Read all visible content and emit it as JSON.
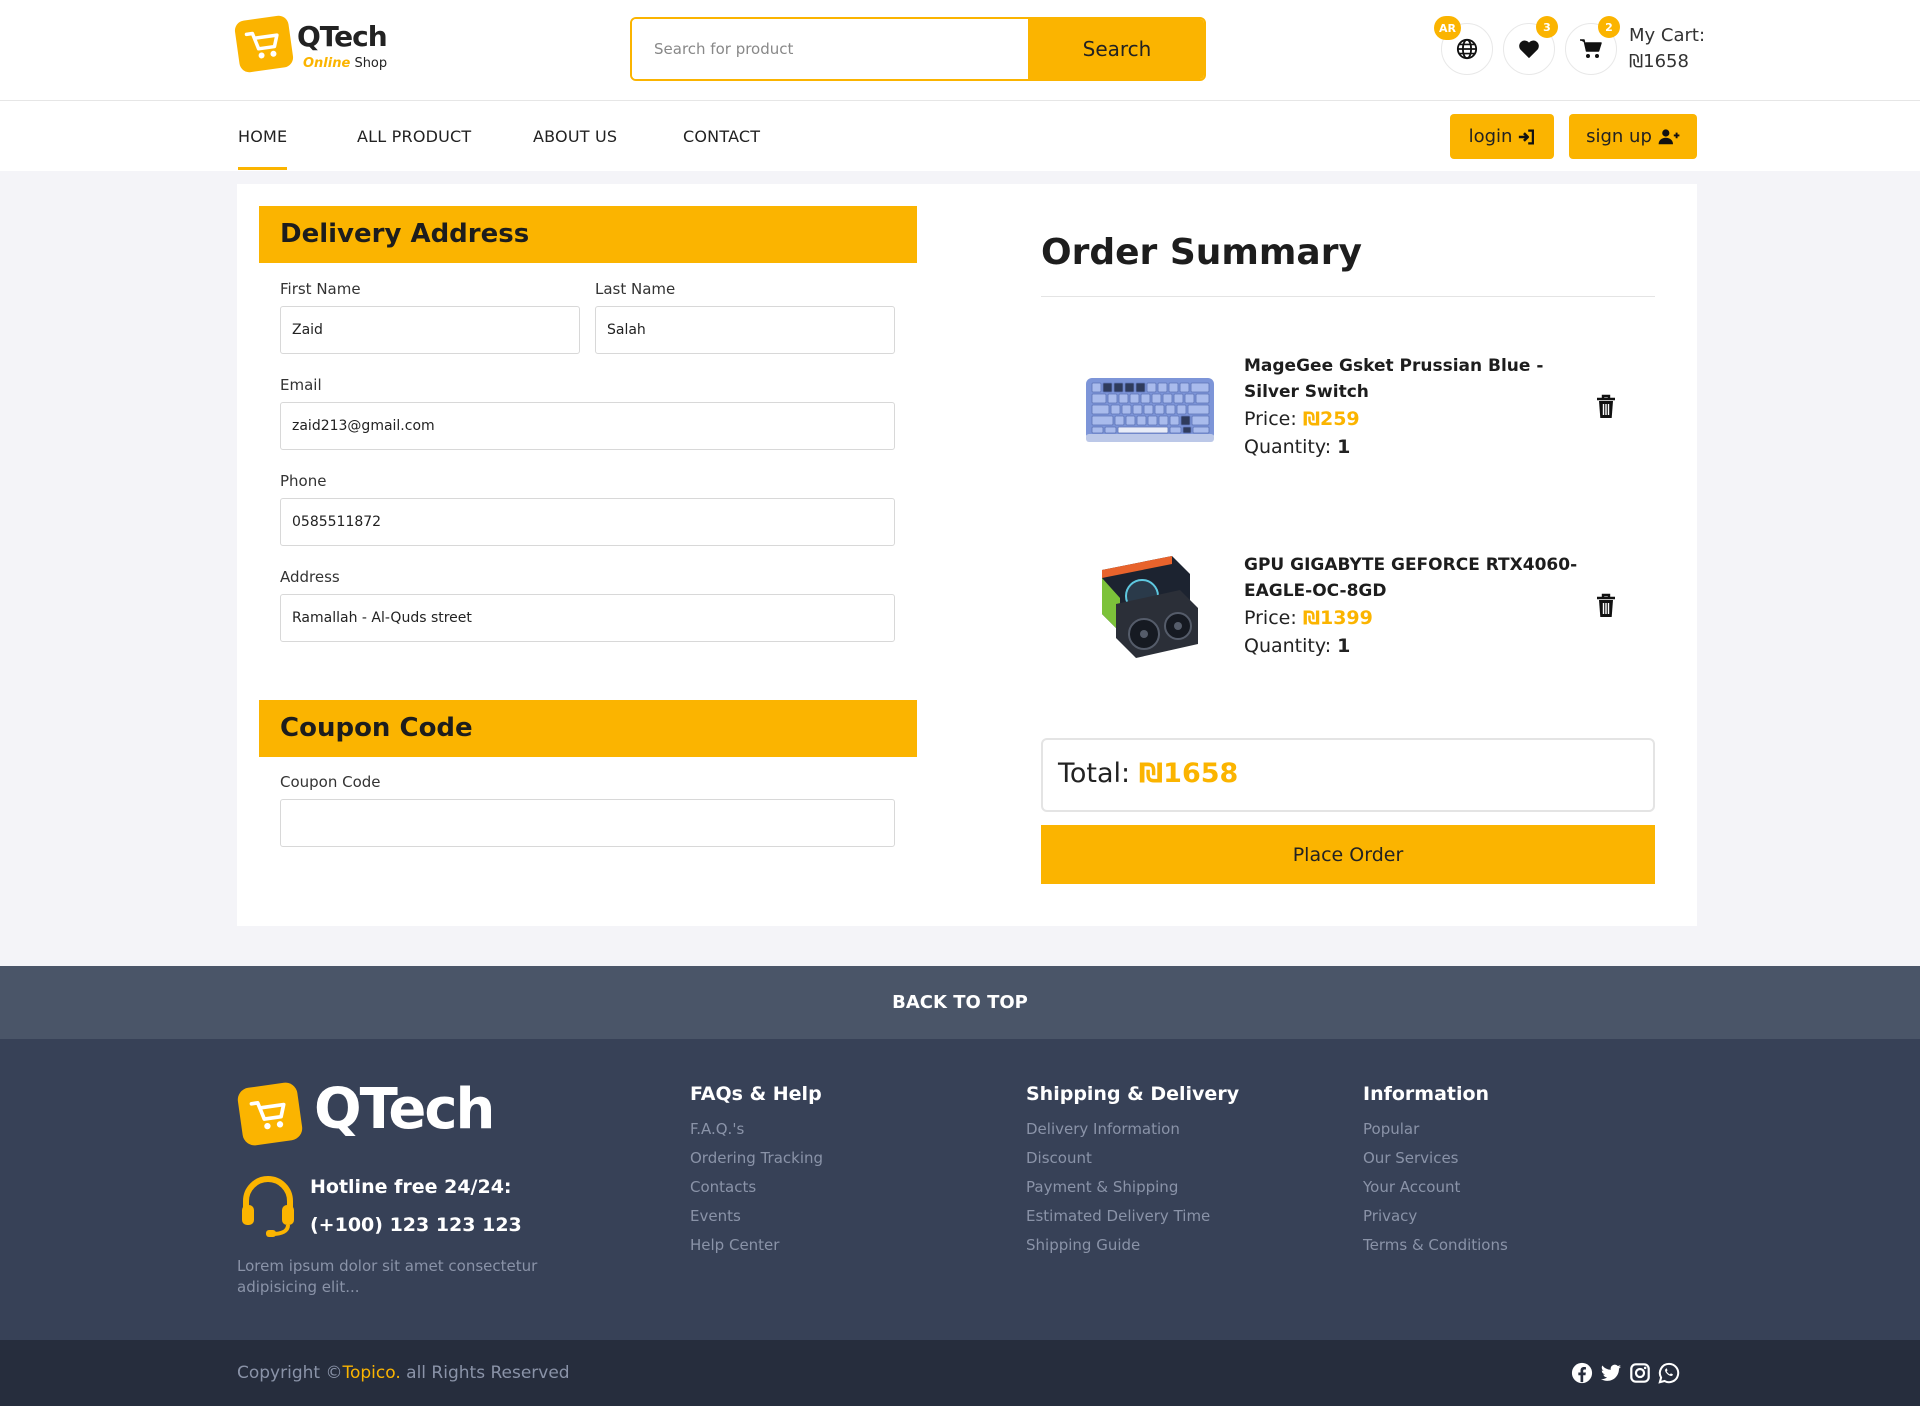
{
  "colors": {
    "accent": "#fbb400",
    "footer": "#374157",
    "back_to_top": "#4a5568",
    "bottom_bar": "#262d3d"
  },
  "header": {
    "logo_name": "QTech",
    "logo_sub_accent": "Online",
    "logo_sub_rest": "Shop",
    "search_placeholder": "Search for product",
    "search_button": "Search",
    "lang_badge": "AR",
    "wishlist_count": "3",
    "cart_count": "2",
    "cart_label": "My Cart:",
    "cart_total": "₪1658"
  },
  "nav": {
    "items": [
      {
        "label": "HOME",
        "active": true
      },
      {
        "label": "ALL PRODUCT"
      },
      {
        "label": "ABOUT US"
      },
      {
        "label": "CONTACT"
      }
    ],
    "login": "login",
    "signup": "sign up"
  },
  "delivery": {
    "title": "Delivery Address",
    "first_name": {
      "label": "First Name",
      "value": "Zaid"
    },
    "last_name": {
      "label": "Last Name",
      "value": "Salah"
    },
    "email": {
      "label": "Email",
      "value": "zaid213@gmail.com"
    },
    "phone": {
      "label": "Phone",
      "value": "0585511872"
    },
    "address": {
      "label": "Address",
      "value": "Ramallah - Al-Quds street"
    }
  },
  "coupon": {
    "title": "Coupon Code",
    "label": "Coupon Code",
    "value": ""
  },
  "summary": {
    "title": "Order Summary",
    "price_label": "Price:",
    "quantity_label": "Quantity:",
    "items": [
      {
        "name": "MageGee Gsket Prussian Blue - Silver Switch",
        "price": "₪259",
        "quantity": "1",
        "image": "keyboard-image"
      },
      {
        "name": "GPU GIGABYTE GEFORCE RTX4060-EAGLE-OC-8GD",
        "price": "₪1399",
        "quantity": "1",
        "image": "gpu-image"
      }
    ],
    "total_label": "Total:",
    "total_value": "₪1658",
    "place_order": "Place Order"
  },
  "back_to_top": "BACK TO TOP",
  "footer": {
    "logo_name": "QTech",
    "hotline_title": "Hotline free 24/24:",
    "hotline_number": "(+100) 123 123 123",
    "lorem": "Lorem ipsum dolor sit amet consectetur adipisicing elit...",
    "columns": [
      {
        "title": "FAQs & Help",
        "links": [
          "F.A.Q.'s",
          "Ordering Tracking",
          "Contacts",
          "Events",
          "Help Center"
        ]
      },
      {
        "title": "Shipping & Delivery",
        "links": [
          "Delivery Information",
          "Discount",
          "Payment & Shipping",
          "Estimated Delivery Time",
          "Shipping Guide"
        ]
      },
      {
        "title": "Information",
        "links": [
          "Popular",
          "Our Services",
          "Your Account",
          "Privacy",
          "Terms & Conditions"
        ]
      }
    ],
    "copyright_prefix": "Copyright ©",
    "copyright_brand": "Topico.",
    "copyright_suffix": " all Rights Reserved",
    "social_icons": [
      "facebook-icon",
      "twitter-icon",
      "instagram-icon",
      "whatsapp-icon"
    ]
  }
}
